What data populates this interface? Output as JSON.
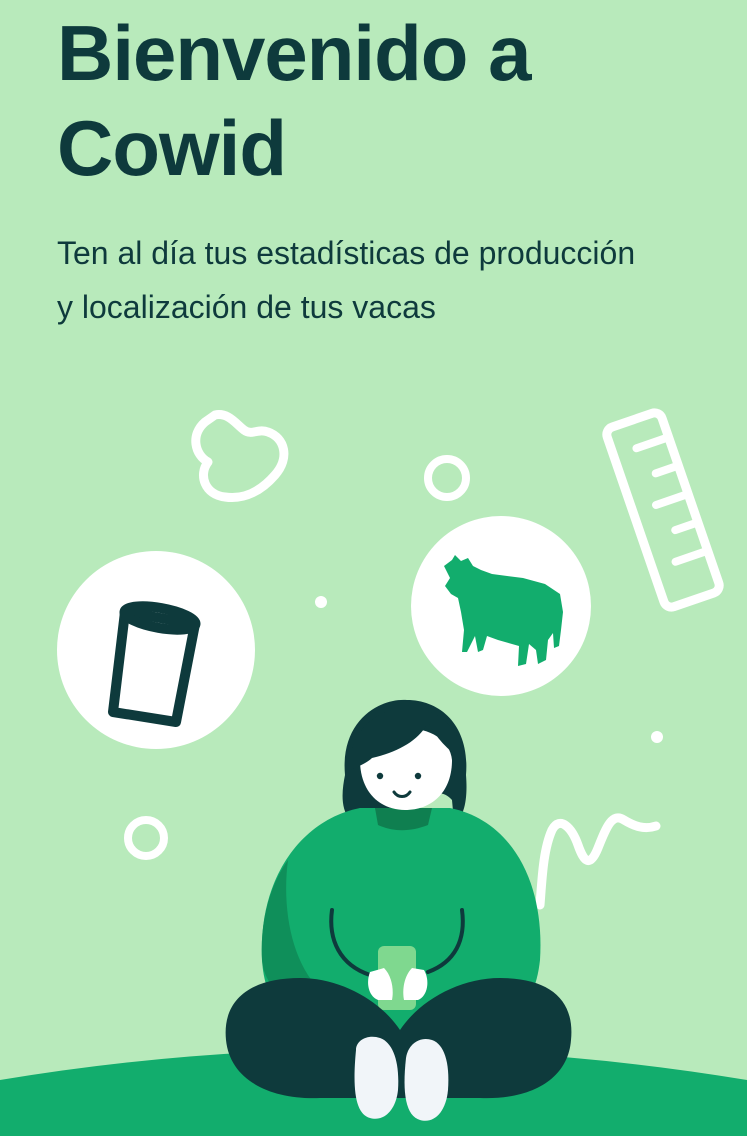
{
  "welcome": {
    "title_line1": "Bienvenido a",
    "title_line2": "Cowid",
    "subtitle_line1": "Ten al día tus estadísticas de producción",
    "subtitle_line2": "y localización de tus vacas"
  },
  "colors": {
    "background": "#b8eabb",
    "text": "#0e3a3c",
    "accent_green": "#12ad6d",
    "dark_green": "#0f7f50",
    "dark_navy": "#0e3a3c",
    "white": "#ffffff"
  },
  "illustration": {
    "icons": [
      "milk-glass-icon",
      "cow-icon",
      "ruler-icon",
      "blob-icon"
    ]
  }
}
